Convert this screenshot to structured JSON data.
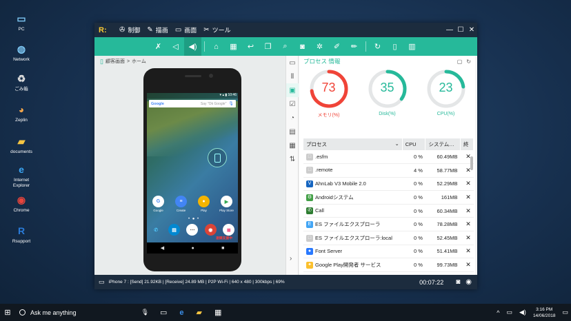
{
  "desktop": {
    "icons": [
      {
        "label": "PC",
        "icon": "computer-icon"
      },
      {
        "label": "Network",
        "icon": "network-icon"
      },
      {
        "label": "ごみ箱",
        "icon": "recycle-bin-icon"
      },
      {
        "label": "Zeplin",
        "icon": "zeplin-icon"
      },
      {
        "label": "documents",
        "icon": "folder-icon"
      },
      {
        "label": "Internet\nExplorer",
        "icon": "ie-icon"
      },
      {
        "label": "Chrome",
        "icon": "chrome-icon"
      },
      {
        "label": "Rsupport",
        "icon": "rsupport-icon"
      }
    ]
  },
  "window": {
    "logo": "R:",
    "menu": [
      "制御",
      "描画",
      "画面",
      "ツール"
    ],
    "accent_color": "#26b99a",
    "dark_color": "#1c2c3e"
  },
  "breadcrumb": {
    "root": "顧客画面",
    "sep": ">",
    "current": "ホーム"
  },
  "phone": {
    "google_search_hint": "Say \"Ok Google\"",
    "google_logo": "Google",
    "apps_row1": [
      {
        "label": "Google",
        "bg": "#fff",
        "glyph": "G",
        "color": "#4285f4"
      },
      {
        "label": "Create",
        "bg": "#4285f4",
        "glyph": "≡",
        "color": "#fff"
      },
      {
        "label": "Play",
        "bg": "#f4b400",
        "glyph": "●",
        "color": "#fff"
      },
      {
        "label": "Play Store",
        "bg": "#ffffff",
        "glyph": "▶",
        "color": "#34a853"
      }
    ],
    "dock": [
      {
        "label": "",
        "bg": "transparent",
        "glyph": "✆",
        "color": "#4fc3f7"
      },
      {
        "label": "",
        "bg": "#0288d1",
        "glyph": "▤",
        "color": "#fff"
      },
      {
        "label": "",
        "bg": "#fff",
        "glyph": "⋯",
        "color": "#333"
      },
      {
        "label": "",
        "bg": "#db4437",
        "glyph": "◉",
        "color": "#fff"
      },
      {
        "label": "",
        "bg": "#ffffff",
        "glyph": "◼",
        "color": "#f06292"
      }
    ],
    "red_tag": "遠隔支援中"
  },
  "panel": {
    "title": "プロセス 情報",
    "gauges": [
      {
        "value": 73,
        "label": "メモリ(%)",
        "color": "#f04438"
      },
      {
        "value": 35,
        "label": "Disk(%)",
        "color": "#26b99a"
      },
      {
        "value": 23,
        "label": "CPU(%)",
        "color": "#26b99a"
      }
    ],
    "columns": [
      "プロセス",
      "CPU",
      "システム…",
      "終"
    ],
    "rows": [
      {
        "name": ".esfm",
        "cpu": "0 %",
        "mem": "60.49MB",
        "icon_color": "#ccc",
        "glyph": "□"
      },
      {
        "name": ".remote",
        "cpu": "4 %",
        "mem": "58.77MB",
        "icon_color": "#ccc",
        "glyph": "□"
      },
      {
        "name": "AhnLab V3 Mobile 2.0",
        "cpu": "0 %",
        "mem": "52.29MB",
        "icon_color": "#1565c0",
        "glyph": "V"
      },
      {
        "name": "Androidシステム",
        "cpu": "0 %",
        "mem": "161MB",
        "icon_color": "#43a047",
        "glyph": "⚙"
      },
      {
        "name": "Call",
        "cpu": "0 %",
        "mem": "60.34MB",
        "icon_color": "#2e7d32",
        "glyph": "✆"
      },
      {
        "name": "ES ファイルエクスプローラ",
        "cpu": "0 %",
        "mem": "78.28MB",
        "icon_color": "#42a5f5",
        "glyph": "E"
      },
      {
        "name": "ES ファイルエクスプローラ:local",
        "cpu": "0 %",
        "mem": "52.45MB",
        "icon_color": "#ccc",
        "glyph": "□"
      },
      {
        "name": "Font Server",
        "cpu": "0 %",
        "mem": "51.41MB",
        "icon_color": "#2979ff",
        "glyph": "●"
      },
      {
        "name": "Google Play開発者 サービス",
        "cpu": "0 %",
        "mem": "99.73MB",
        "icon_color": "#fbc02d",
        "glyph": "✦"
      }
    ],
    "close_glyph": "✕"
  },
  "status": {
    "info": "iPhone 7 : [Send] 21.92KB  | [Receive] 24.89 MB | P2P Wi-Fi | 640 x 480 | 300kbps | 69%",
    "timer": "00:07:22"
  },
  "taskbar": {
    "search_placeholder": "Ask me anything",
    "time": "3:16 PM",
    "date": "14/06/2018"
  }
}
